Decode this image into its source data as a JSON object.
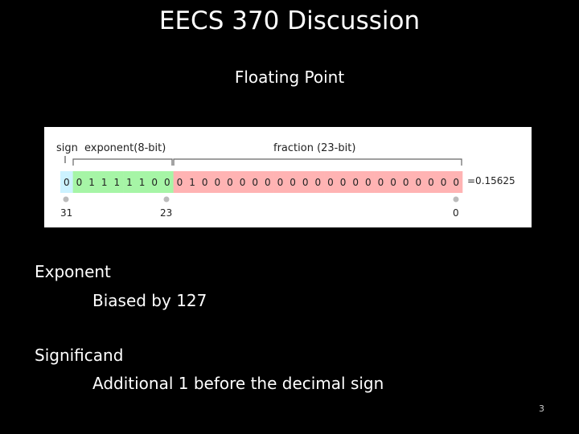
{
  "slide": {
    "title": "EECS 370 Discussion",
    "subtitle": "Floating Point",
    "page_number": "3"
  },
  "figure": {
    "labels": {
      "sign": "sign",
      "exponent": "exponent(8-bit)",
      "fraction": "fraction (23-bit)"
    },
    "bits": [
      "0",
      "0",
      "1",
      "1",
      "1",
      "1",
      "1",
      "0",
      "0",
      "0",
      "1",
      "0",
      "0",
      "0",
      "0",
      "0",
      "0",
      "0",
      "0",
      "0",
      "0",
      "0",
      "0",
      "0",
      "0",
      "0",
      "0",
      "0",
      "0",
      "0",
      "0",
      "0"
    ],
    "value": "=0.15625",
    "bit_index_labels": [
      "31",
      "23",
      "0"
    ],
    "colors": {
      "sign": "#ccf2ff",
      "exponent": "#a6f5a6",
      "fraction": "#ffb3b3"
    }
  },
  "content": {
    "items": [
      {
        "heading": "Exponent",
        "detail": "Biased by 127"
      },
      {
        "heading": "Significand",
        "detail": "Additional 1 before the decimal sign"
      }
    ]
  }
}
